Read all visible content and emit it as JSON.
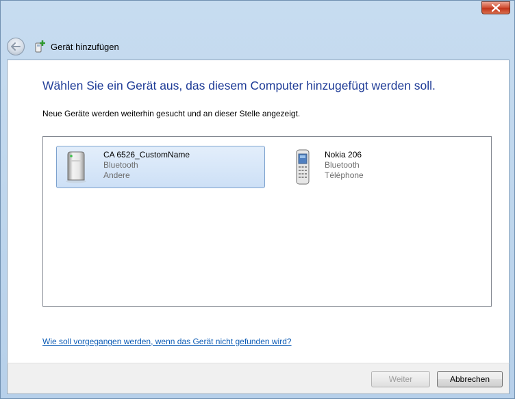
{
  "window": {
    "title": "Gerät hinzufügen"
  },
  "content": {
    "instruction": "Wählen Sie ein Gerät aus, das diesem Computer hinzugefügt werden soll.",
    "subtext": "Neue Geräte werden weiterhin gesucht und an dieser Stelle angezeigt.",
    "devices": [
      {
        "name": "CA 6526_CustomName",
        "type": "Bluetooth",
        "category": "Andere",
        "icon": "generic-device-icon",
        "selected": true
      },
      {
        "name": "Nokia 206",
        "type": "Bluetooth",
        "category": "Téléphone",
        "icon": "mobile-phone-icon",
        "selected": false
      }
    ],
    "help_link": "Wie soll vorgegangen werden, wenn das Gerät nicht gefunden wird?"
  },
  "footer": {
    "next_label": "Weiter",
    "cancel_label": "Abbrechen"
  },
  "colors": {
    "instruction_blue": "#1f3c97",
    "link_blue": "#0b5bb5",
    "close_red": "#c2351c"
  }
}
